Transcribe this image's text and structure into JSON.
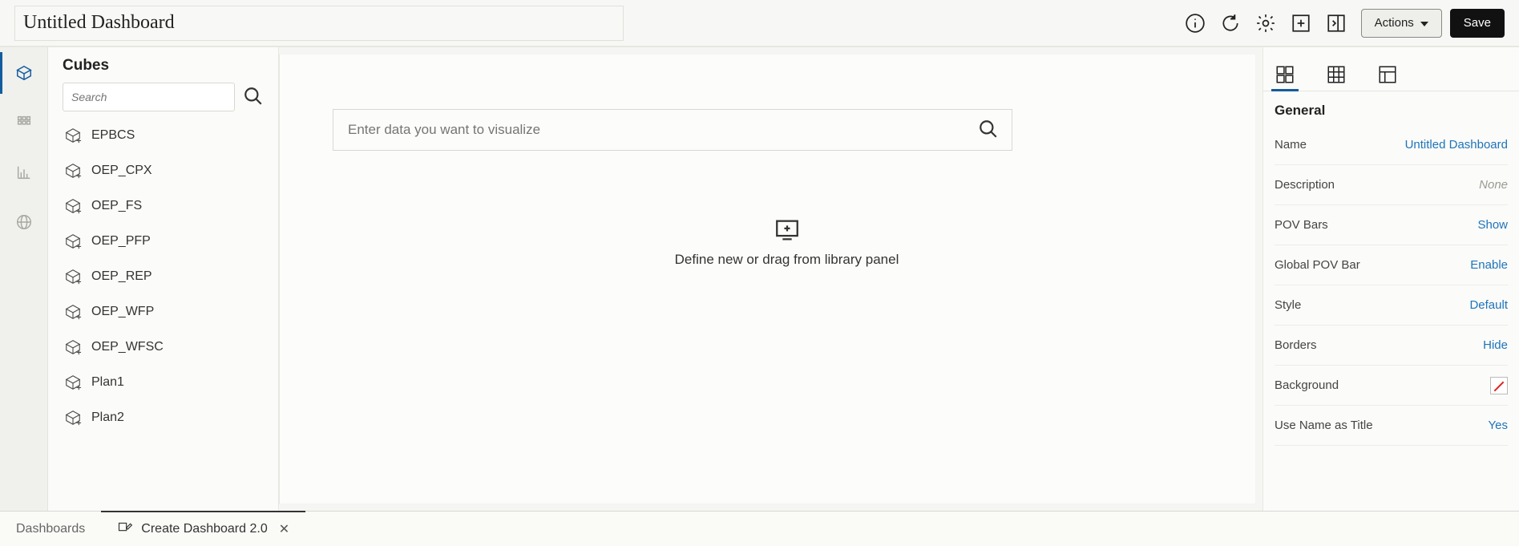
{
  "header": {
    "title_value": "Untitled Dashboard",
    "actions_label": "Actions",
    "save_label": "Save"
  },
  "cubes_panel": {
    "title": "Cubes",
    "search_placeholder": "Search",
    "items": [
      "EPBCS",
      "OEP_CPX",
      "OEP_FS",
      "OEP_PFP",
      "OEP_REP",
      "OEP_WFP",
      "OEP_WFSC",
      "Plan1",
      "Plan2"
    ]
  },
  "canvas": {
    "viz_search_placeholder": "Enter data you want to visualize",
    "dropzone_text": "Define new or drag from library panel"
  },
  "properties": {
    "section_title": "General",
    "rows": {
      "name": {
        "label": "Name",
        "value": "Untitled Dashboard"
      },
      "description": {
        "label": "Description",
        "value": "None"
      },
      "pov_bars": {
        "label": "POV Bars",
        "value": "Show"
      },
      "global_pov": {
        "label": "Global POV Bar",
        "value": "Enable"
      },
      "style": {
        "label": "Style",
        "value": "Default"
      },
      "borders": {
        "label": "Borders",
        "value": "Hide"
      },
      "background": {
        "label": "Background",
        "value": ""
      },
      "use_name_title": {
        "label": "Use Name as Title",
        "value": "Yes"
      }
    }
  },
  "footer": {
    "tab_dashboards": "Dashboards",
    "tab_create": "Create Dashboard 2.0"
  }
}
